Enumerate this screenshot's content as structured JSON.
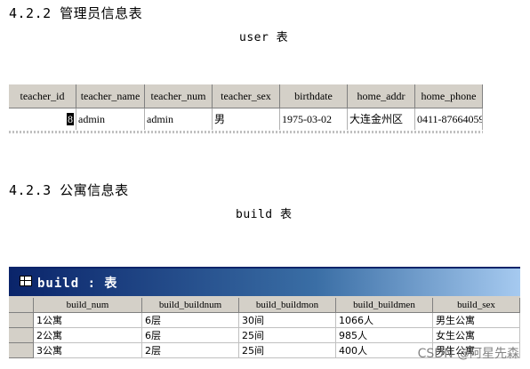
{
  "section1": {
    "heading": "4.2.2 管理员信息表",
    "caption": "user  表"
  },
  "table1": {
    "columns": [
      "teacher_id",
      "teacher_name",
      "teacher_num",
      "teacher_sex",
      "birthdate",
      "home_addr",
      "home_phone"
    ],
    "row": [
      "8",
      "admin",
      "admin",
      "男",
      "1975-03-02",
      "大连金州区",
      "0411-87664059"
    ]
  },
  "section2": {
    "heading": "4.2.3  公寓信息表",
    "caption": "build  表"
  },
  "window": {
    "title": "build : 表",
    "icon": "table-icon"
  },
  "table2": {
    "columns": [
      "build_num",
      "build_buildnum",
      "build_buildmon",
      "build_buildmen",
      "build_sex"
    ],
    "rows": [
      [
        "1公寓",
        "6层",
        "30间",
        "1066人",
        "男生公寓"
      ],
      [
        "2公寓",
        "6层",
        "25间",
        "985人",
        "女生公寓"
      ],
      [
        "3公寓",
        "2层",
        "25间",
        "400人",
        "男生公寓"
      ]
    ]
  },
  "watermark": "CSDN @阿星先森"
}
